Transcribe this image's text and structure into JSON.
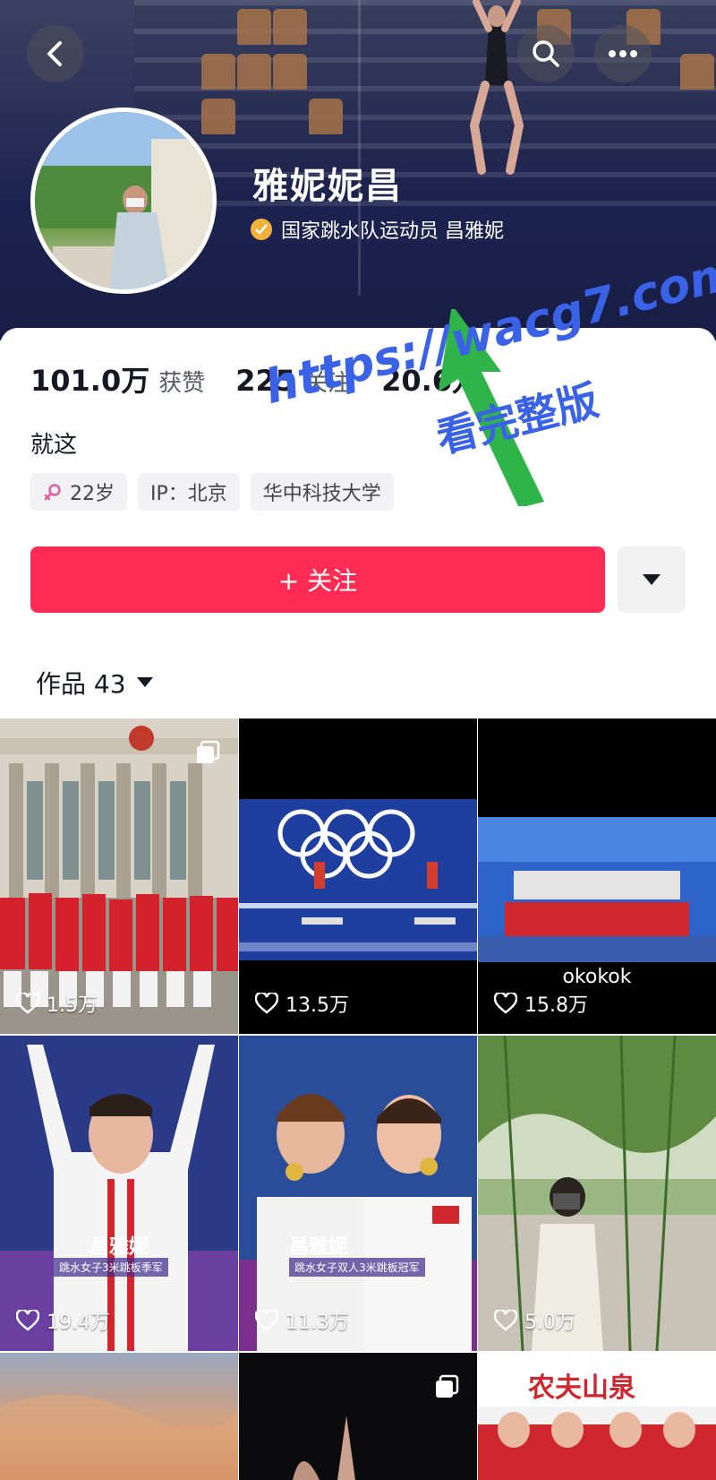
{
  "profile": {
    "name": "雅妮妮昌",
    "verify_text": "国家跳水队运动员 昌雅妮",
    "bio": "就这"
  },
  "stats": [
    {
      "value": "101.0万",
      "label": "获赞"
    },
    {
      "value": "225",
      "label": "关注"
    },
    {
      "value": "20.6万",
      "label": ""
    }
  ],
  "tags": {
    "age": "22岁",
    "ip": "IP：北京",
    "school": "华中科技大学"
  },
  "actions": {
    "follow_label": "+ 关注"
  },
  "works": {
    "label": "作品 43"
  },
  "grid": [
    {
      "likes": "1.5万",
      "multi": true
    },
    {
      "likes": "13.5万",
      "multi": false
    },
    {
      "likes": "15.8万",
      "multi": false,
      "caption": "okokok"
    },
    {
      "likes": "19.4万",
      "multi": false,
      "overlay_name": "昌雅妮",
      "overlay_sub": "跳水女子3米跳板季军"
    },
    {
      "likes": "11.3万",
      "multi": false,
      "overlay_name": "昌雅妮",
      "overlay_sub": "跳水女子双人3米跳板冠军"
    },
    {
      "likes": "5.0万",
      "multi": false
    },
    {
      "likes": "",
      "multi": false
    },
    {
      "likes": "",
      "multi": true
    },
    {
      "likes": "",
      "multi": true,
      "banner": "农夫山泉"
    }
  ],
  "watermark": {
    "url": "https://wacg7.com",
    "text": "看完整版"
  },
  "colors": {
    "accent": "#fe2c55",
    "verify_badge": "#f3b13a",
    "watermark": "#3a62e6",
    "arrow": "#2fb44a"
  }
}
